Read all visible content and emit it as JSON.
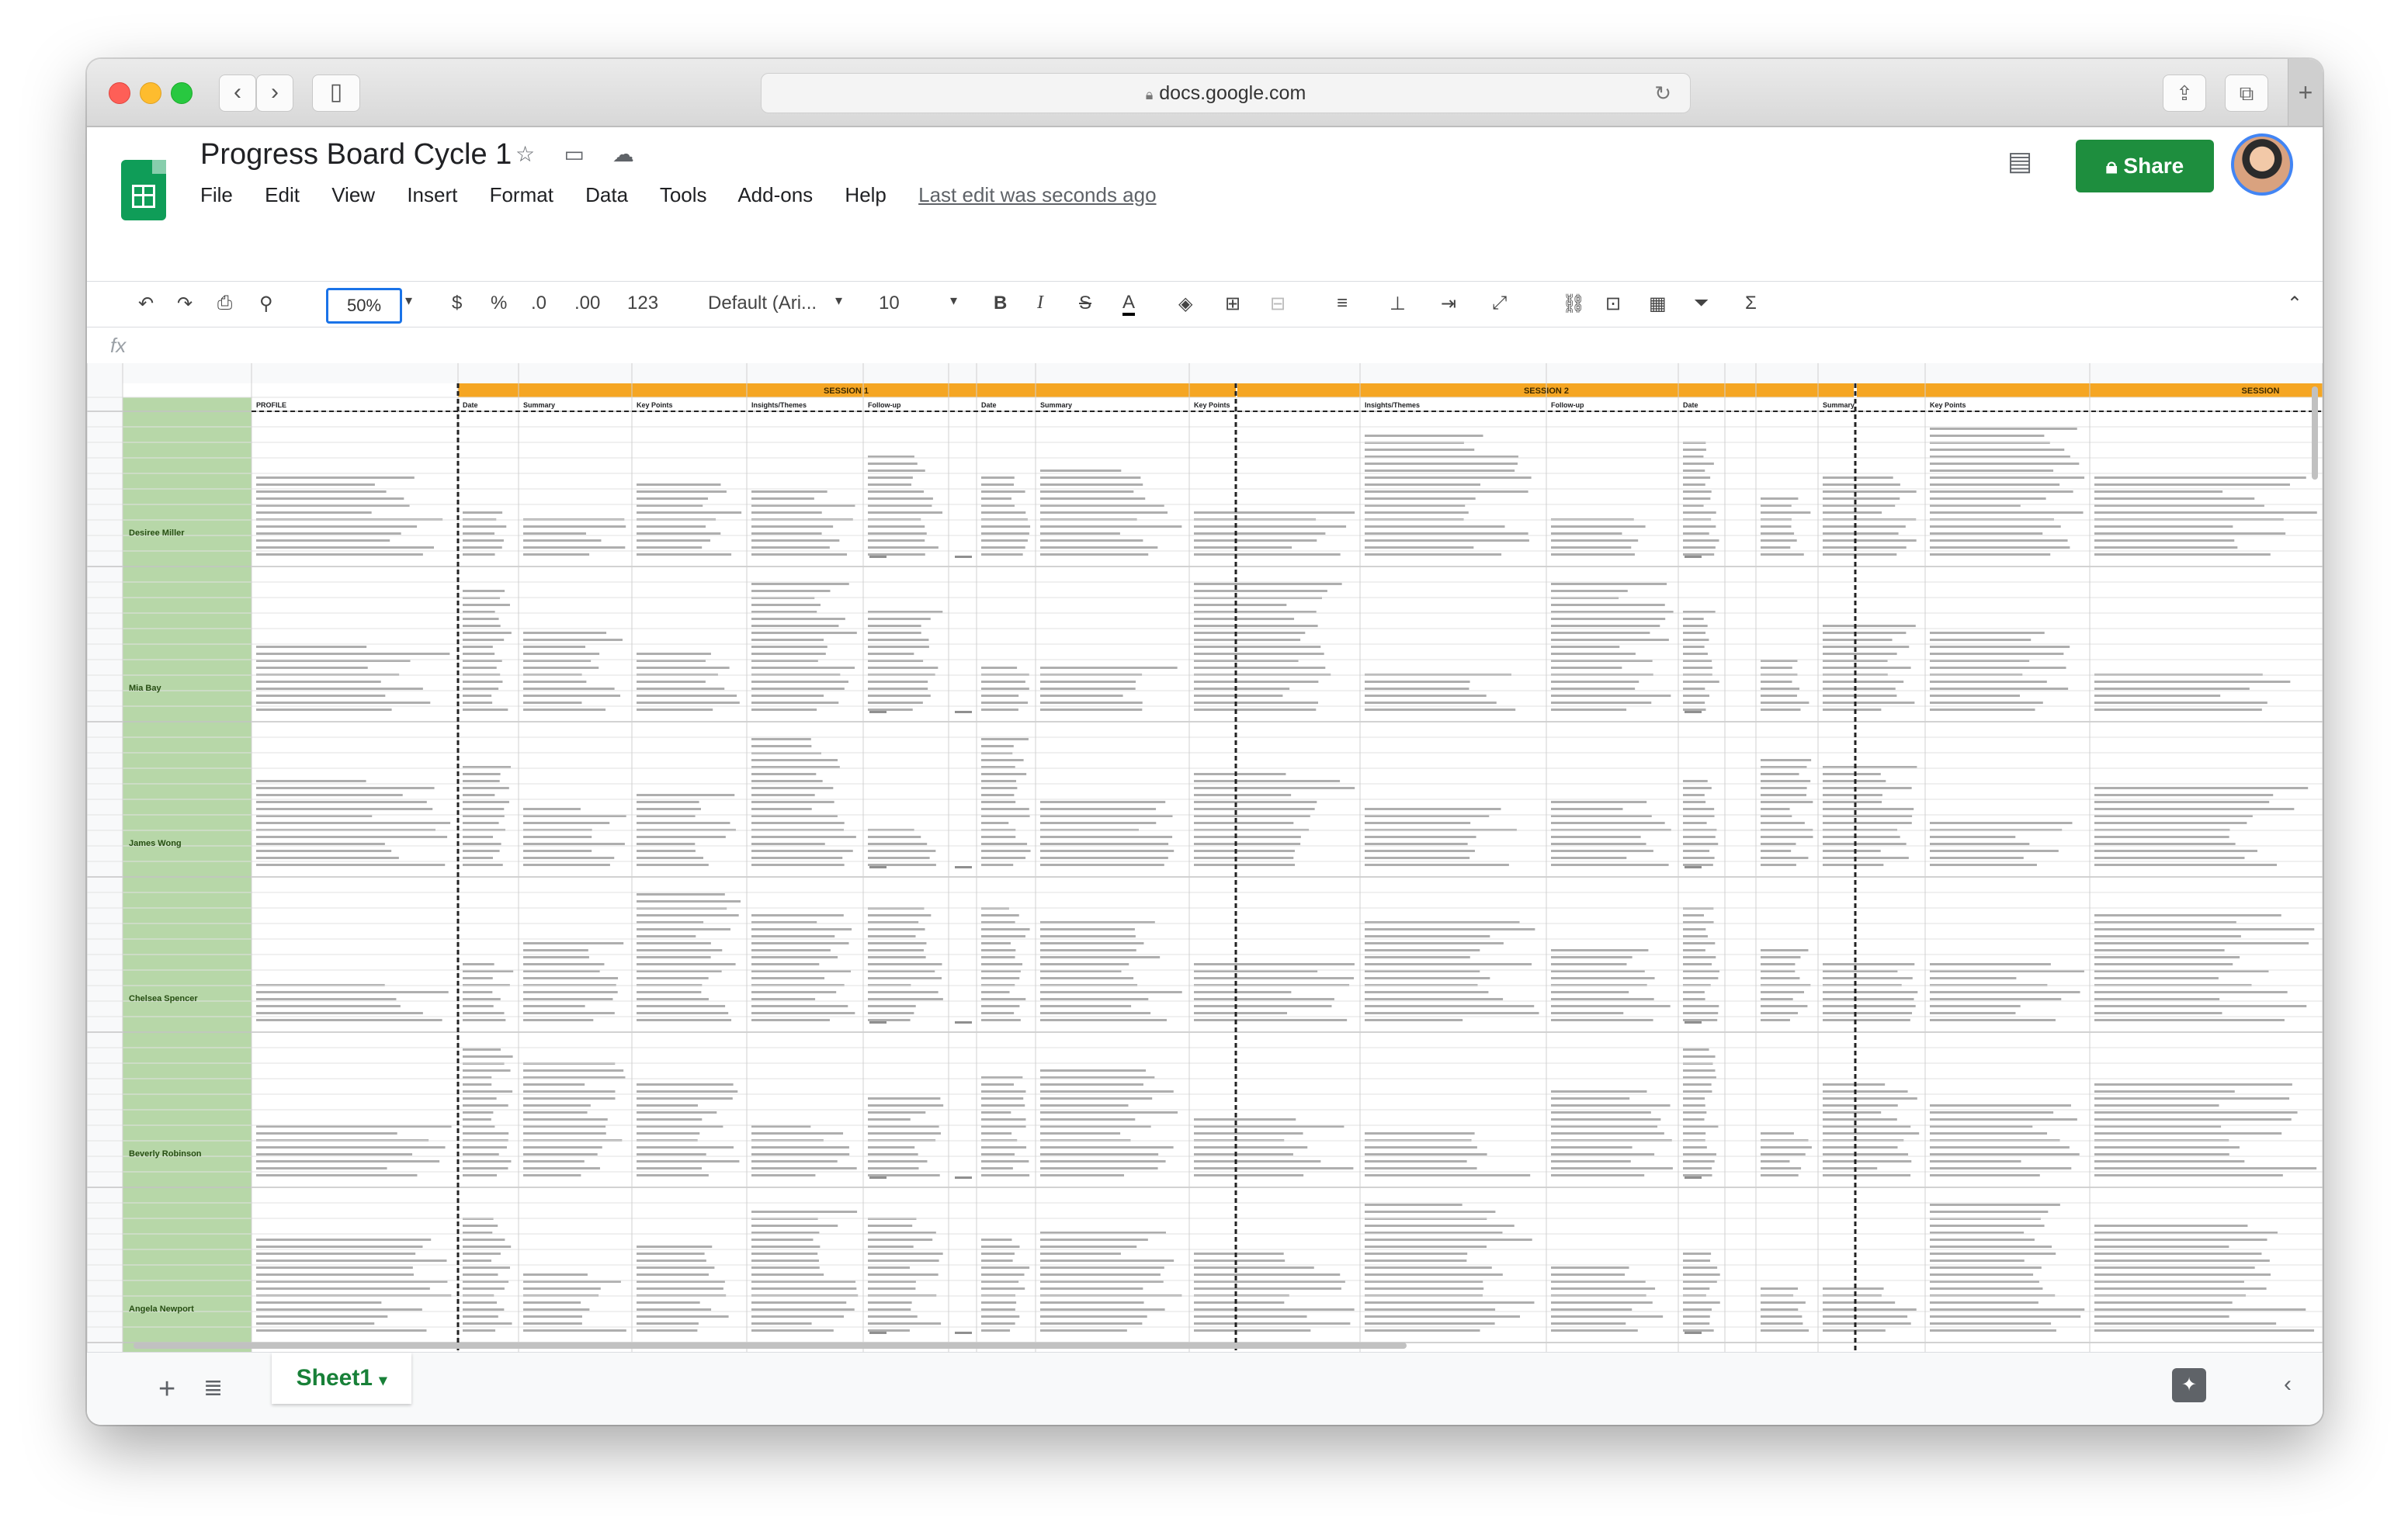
{
  "browser": {
    "url": "docs.google.com",
    "back_icon": "chevron-left-icon",
    "forward_icon": "chevron-right-icon"
  },
  "app": {
    "title": "Progress Board Cycle 1",
    "menu": [
      "File",
      "Edit",
      "View",
      "Insert",
      "Format",
      "Data",
      "Tools",
      "Add-ons",
      "Help"
    ],
    "last_edit": "Last edit was seconds ago",
    "share_label": "Share"
  },
  "toolbar": {
    "zoom": "50%",
    "currency": "$",
    "percent": "%",
    "decimal_less": ".0",
    "decimal_more": ".00",
    "number_format": "123",
    "font": "Default (Ari...",
    "font_size": "10",
    "bold": "B",
    "italic": "I",
    "strike": "S",
    "text_color": "A"
  },
  "formula_bar": {
    "fx": "fx"
  },
  "sheet": {
    "section_headers": [
      "SESSION 1",
      "SESSION 2",
      "SESSION"
    ],
    "header_color": "#f5a623",
    "name_column_color": "#b7d7a8",
    "column_headers": [
      "PROFILE",
      "Date",
      "Summary",
      "Key Points",
      "Insights/Themes",
      "Follow-up",
      "Date",
      "Summary",
      "Key Points",
      "Insights/Themes",
      "Follow-up",
      "Date",
      "Summary",
      "Key Points"
    ],
    "rows": [
      {
        "name": "Desiree Miller"
      },
      {
        "name": "Mia Bay"
      },
      {
        "name": "James Wong"
      },
      {
        "name": "Chelsea Spencer"
      },
      {
        "name": "Beverly Robinson"
      },
      {
        "name": "Angela Newport"
      }
    ]
  },
  "bottom": {
    "sheet_tab": "Sheet1"
  }
}
